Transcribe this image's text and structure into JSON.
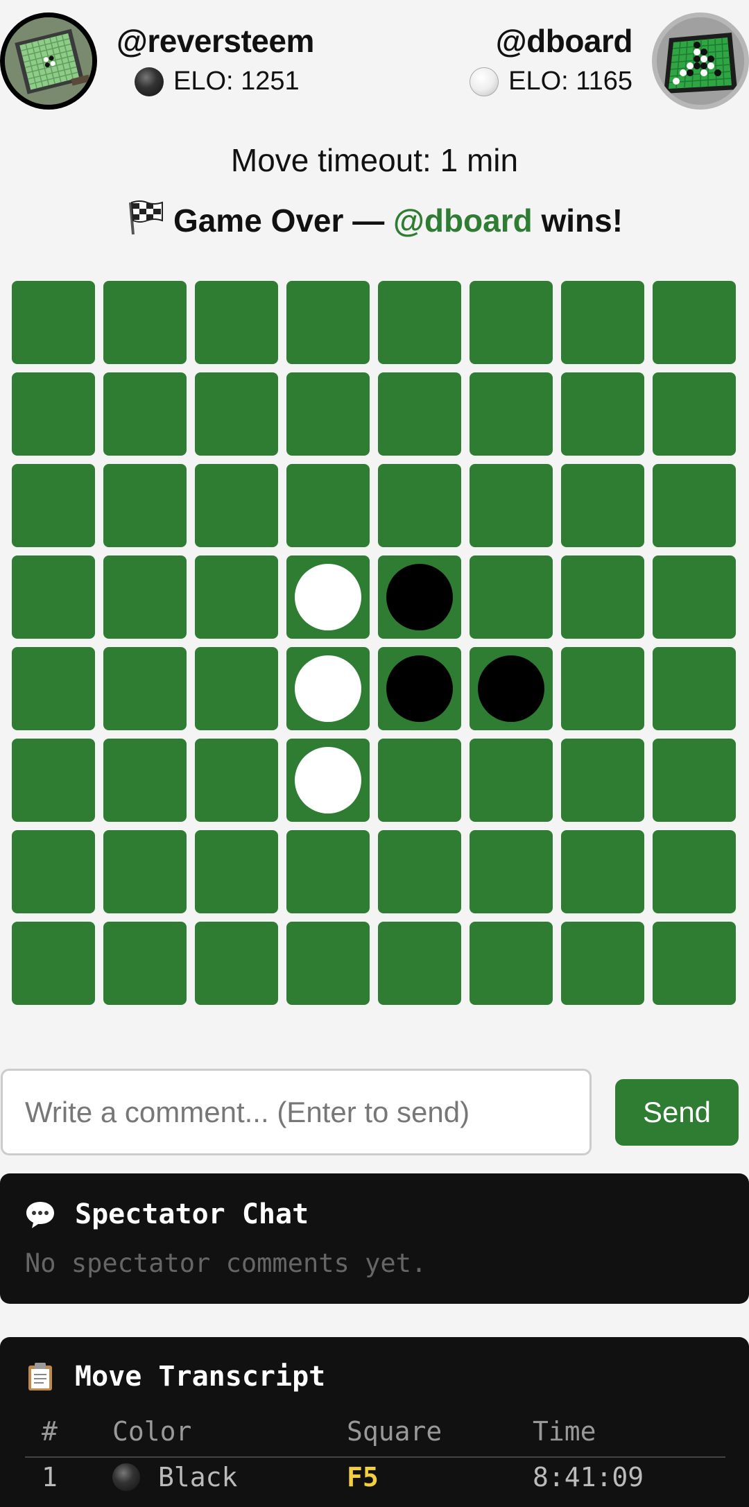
{
  "players": {
    "black": {
      "name": "@reversteem",
      "elo_label": "ELO: 1251",
      "color": "black"
    },
    "white": {
      "name": "@dboard",
      "elo_label": "ELO: 1165",
      "color": "white"
    }
  },
  "game": {
    "timeout_label": "Move timeout: 1 min",
    "status_prefix": "Game Over — ",
    "winner": "@dboard",
    "status_suffix": " wins!"
  },
  "board": {
    "rows": [
      "........",
      "........",
      "........",
      "...WB...",
      "...WBB..",
      "...W....",
      "........",
      "........"
    ],
    "cell_color": "#2e7d32"
  },
  "comment": {
    "placeholder": "Write a comment... (Enter to send)",
    "send_label": "Send"
  },
  "chat": {
    "title": "Spectator Chat",
    "empty_text": "No spectator comments yet."
  },
  "transcript": {
    "title": "Move Transcript",
    "headers": {
      "num": "#",
      "color": "Color",
      "square": "Square",
      "time": "Time"
    },
    "moves": [
      {
        "num": "1",
        "color": "Black",
        "square": "F5",
        "time": "8:41:09"
      }
    ]
  },
  "colors": {
    "accent": "#2e7d32",
    "square_highlight": "#f4d03f",
    "panel_bg": "#111111"
  }
}
